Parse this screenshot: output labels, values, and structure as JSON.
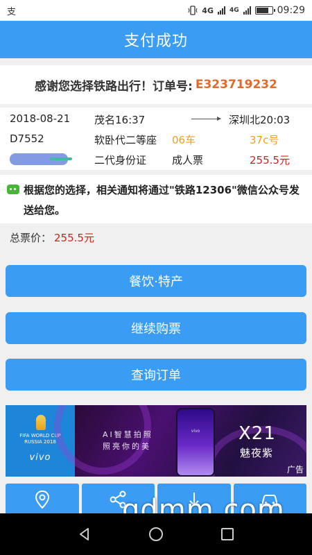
{
  "status_bar": {
    "notification_icon": "支",
    "network": "4G",
    "network2": "4G",
    "time": "09:29",
    "battery_level": 0.85
  },
  "header": {
    "title": "支付成功"
  },
  "thanks": {
    "text": "感谢您选择铁路出行！订单号:",
    "order_no": "E323719232"
  },
  "ticket": {
    "date": "2018-08-21",
    "from": "茂名16:37",
    "to": "深圳北20:03",
    "train_no": "D7552",
    "seat_type": "软卧代二等座",
    "car": "06车",
    "seat": "37c号",
    "id_type": "二代身份证",
    "ticket_type": "成人票",
    "price": "255.5元"
  },
  "notice": {
    "text": "根据您的选择，相关通知将通过\"铁路12306\"微信公众号发送给您。"
  },
  "total": {
    "label": "总票价：",
    "value": "255.5元"
  },
  "buttons": {
    "food": "餐饮·特产",
    "continue": "继续购票",
    "query": "查询订单"
  },
  "ad": {
    "fwc_line1": "FIFA WORLD CUP",
    "fwc_line2": "RUSSIA 2018",
    "brand": "vivo",
    "phone_logo": "vivo",
    "slogan_line1": "AI智慧拍照",
    "slogan_line2": "照亮你的美",
    "model": "X21",
    "color_name": "魅夜紫",
    "ad_label": "广告"
  },
  "watermark": "gdmm.com",
  "colors": {
    "primary": "#3a9cf2",
    "order": "#e06a2a",
    "car": "#f0a020",
    "price": "#d42020"
  },
  "icons": {
    "tile1": "location-pin-icon",
    "tile2": "share-icon",
    "tile3": "arrow-icon",
    "tile4": "car-icon"
  }
}
